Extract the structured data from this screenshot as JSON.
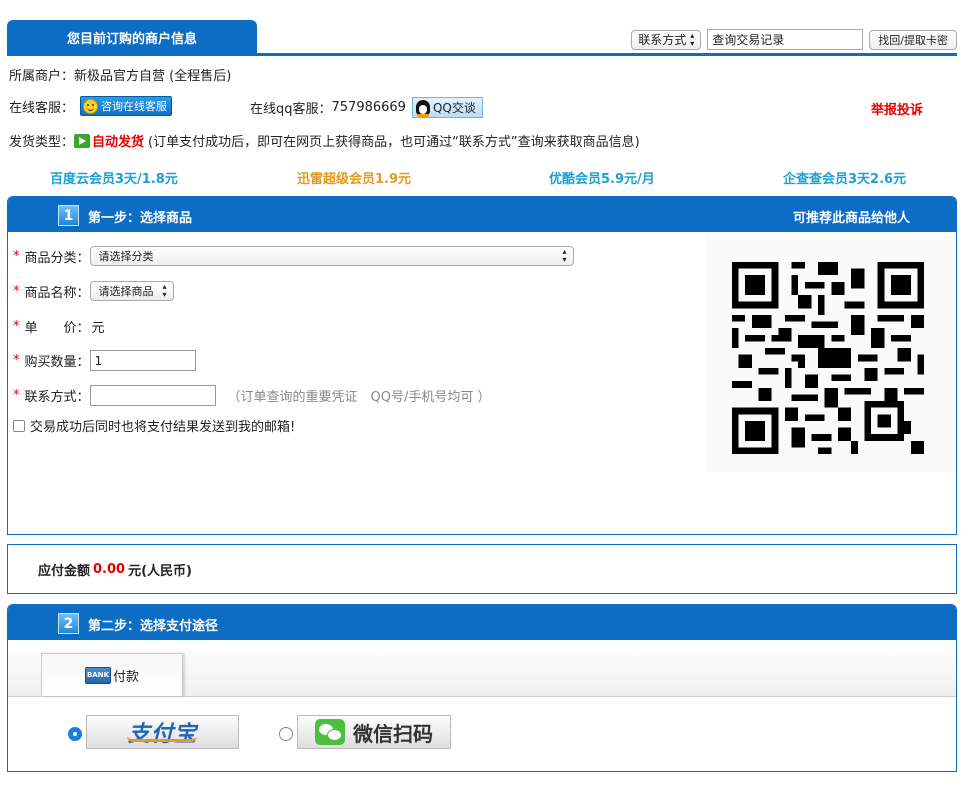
{
  "header": {
    "title": "您目前订购的商户信息",
    "contact_select": "联系方式",
    "query_input_value": "查询交易记录",
    "retrieve_button": "找回/提取卡密"
  },
  "merchant": {
    "label": "所属商户：",
    "name": "新极品官方自营 (全程售后)"
  },
  "service": {
    "online_label": "在线客服：",
    "online_button": "咨询在线客服",
    "qq_label": "在线qq客服：",
    "qq_number": "757986669",
    "qq_button": "QQ交谈",
    "report": "举报投诉"
  },
  "delivery": {
    "label": "发货类型：",
    "type": "自动发货",
    "note": "(订单支付成功后，即可在网页上获得商品，也可通过“联系方式”查询来获取商品信息)"
  },
  "promo_links": [
    {
      "label": "百度云会员3天/1.8元",
      "color": "#1ba0d8"
    },
    {
      "label": "迅雷超级会员1.9元",
      "color": "#e39a1e"
    },
    {
      "label": "优酷会员5.9元/月",
      "color": "#1ba0d8"
    },
    {
      "label": "企查查会员3天2.6元",
      "color": "#1ba0d8"
    }
  ],
  "step1": {
    "badge": "1",
    "title": "第一步：选择商品",
    "recommend": "可推荐此商品给他人",
    "category_label": "商品分类：",
    "category_select": "请选择分类",
    "product_label": "商品名称：",
    "product_select": "请选择商品",
    "price_label": "单　　价：",
    "price_value": "元",
    "qty_label": "购买数量：",
    "qty_value": "1",
    "contact_label": "联系方式：",
    "contact_value": "",
    "contact_hint": "（订单查询的重要凭证　QQ号/手机号均可 ）",
    "email_checkbox_label": "交易成功后同时也将支付结果发送到我的邮箱!"
  },
  "amount": {
    "label": "应付金额",
    "value": "0.00",
    "unit": "元(人民币)"
  },
  "step2": {
    "badge": "2",
    "title": "第二步：选择支付途径",
    "tab_label": "付款",
    "bank_icon_text": "BANK",
    "alipay_label": "支付宝",
    "wechat_label": "微信扫码"
  },
  "icons": {
    "online_service": "smiley-icon",
    "qq": "qq-penguin-icon",
    "auto_delivery": "auto-delivery-icon",
    "bank": "bank-card-icon",
    "wechat": "wechat-icon",
    "qrcode": "qr-code"
  }
}
